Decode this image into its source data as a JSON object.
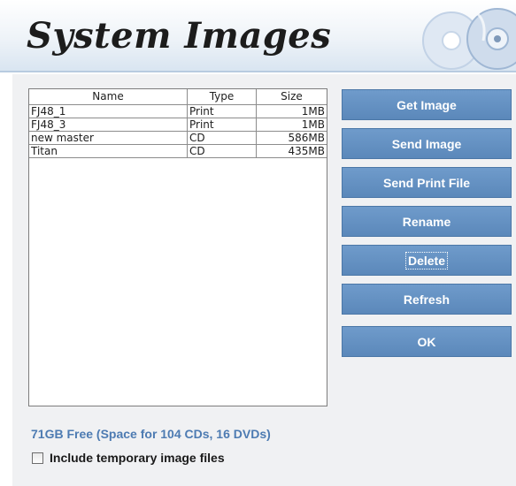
{
  "header": {
    "title": "System Images",
    "art_icon": "disc-icon"
  },
  "images_table": {
    "columns": [
      "Name",
      "Type",
      "Size"
    ],
    "rows": [
      {
        "name": "FJ48_1",
        "type": "Print",
        "size": "1MB"
      },
      {
        "name": "FJ48_3",
        "type": "Print",
        "size": "1MB"
      },
      {
        "name": "new master",
        "type": "CD",
        "size": "586MB"
      },
      {
        "name": "Titan",
        "type": "CD",
        "size": "435MB"
      }
    ]
  },
  "buttons": {
    "get_image": "Get Image",
    "send_image": "Send Image",
    "send_print_file": "Send Print File",
    "rename": "Rename",
    "delete": "Delete",
    "refresh": "Refresh",
    "ok": "OK"
  },
  "status": {
    "free_space": "71GB Free (Space for 104 CDs, 16 DVDs)"
  },
  "options": {
    "include_temp_label": "Include temporary image files",
    "include_temp_checked": false
  },
  "colors": {
    "button_blue": "#5b88ba",
    "accent_text": "#4d7bb2",
    "header_line": "#b8cbe0"
  }
}
